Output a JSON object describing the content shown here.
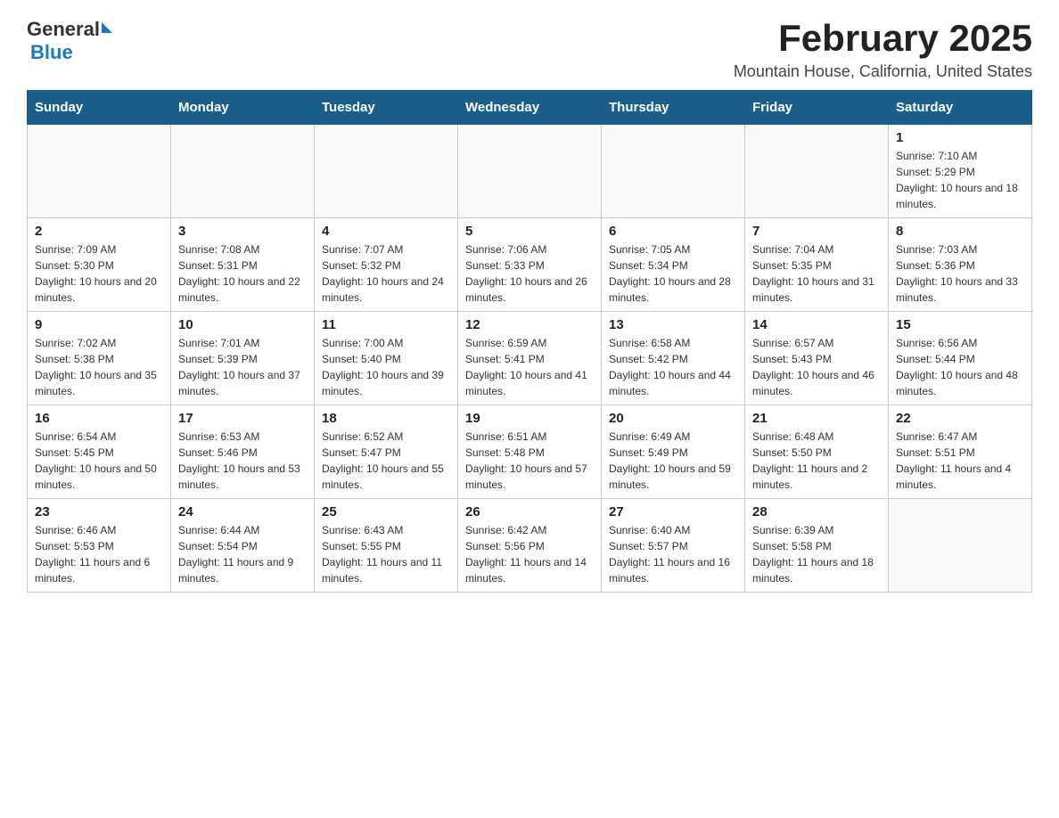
{
  "header": {
    "logo_general": "General",
    "logo_blue": "Blue",
    "title": "February 2025",
    "subtitle": "Mountain House, California, United States"
  },
  "days_of_week": [
    "Sunday",
    "Monday",
    "Tuesday",
    "Wednesday",
    "Thursday",
    "Friday",
    "Saturday"
  ],
  "weeks": [
    [
      {
        "day": "",
        "info": ""
      },
      {
        "day": "",
        "info": ""
      },
      {
        "day": "",
        "info": ""
      },
      {
        "day": "",
        "info": ""
      },
      {
        "day": "",
        "info": ""
      },
      {
        "day": "",
        "info": ""
      },
      {
        "day": "1",
        "info": "Sunrise: 7:10 AM\nSunset: 5:29 PM\nDaylight: 10 hours and 18 minutes."
      }
    ],
    [
      {
        "day": "2",
        "info": "Sunrise: 7:09 AM\nSunset: 5:30 PM\nDaylight: 10 hours and 20 minutes."
      },
      {
        "day": "3",
        "info": "Sunrise: 7:08 AM\nSunset: 5:31 PM\nDaylight: 10 hours and 22 minutes."
      },
      {
        "day": "4",
        "info": "Sunrise: 7:07 AM\nSunset: 5:32 PM\nDaylight: 10 hours and 24 minutes."
      },
      {
        "day": "5",
        "info": "Sunrise: 7:06 AM\nSunset: 5:33 PM\nDaylight: 10 hours and 26 minutes."
      },
      {
        "day": "6",
        "info": "Sunrise: 7:05 AM\nSunset: 5:34 PM\nDaylight: 10 hours and 28 minutes."
      },
      {
        "day": "7",
        "info": "Sunrise: 7:04 AM\nSunset: 5:35 PM\nDaylight: 10 hours and 31 minutes."
      },
      {
        "day": "8",
        "info": "Sunrise: 7:03 AM\nSunset: 5:36 PM\nDaylight: 10 hours and 33 minutes."
      }
    ],
    [
      {
        "day": "9",
        "info": "Sunrise: 7:02 AM\nSunset: 5:38 PM\nDaylight: 10 hours and 35 minutes."
      },
      {
        "day": "10",
        "info": "Sunrise: 7:01 AM\nSunset: 5:39 PM\nDaylight: 10 hours and 37 minutes."
      },
      {
        "day": "11",
        "info": "Sunrise: 7:00 AM\nSunset: 5:40 PM\nDaylight: 10 hours and 39 minutes."
      },
      {
        "day": "12",
        "info": "Sunrise: 6:59 AM\nSunset: 5:41 PM\nDaylight: 10 hours and 41 minutes."
      },
      {
        "day": "13",
        "info": "Sunrise: 6:58 AM\nSunset: 5:42 PM\nDaylight: 10 hours and 44 minutes."
      },
      {
        "day": "14",
        "info": "Sunrise: 6:57 AM\nSunset: 5:43 PM\nDaylight: 10 hours and 46 minutes."
      },
      {
        "day": "15",
        "info": "Sunrise: 6:56 AM\nSunset: 5:44 PM\nDaylight: 10 hours and 48 minutes."
      }
    ],
    [
      {
        "day": "16",
        "info": "Sunrise: 6:54 AM\nSunset: 5:45 PM\nDaylight: 10 hours and 50 minutes."
      },
      {
        "day": "17",
        "info": "Sunrise: 6:53 AM\nSunset: 5:46 PM\nDaylight: 10 hours and 53 minutes."
      },
      {
        "day": "18",
        "info": "Sunrise: 6:52 AM\nSunset: 5:47 PM\nDaylight: 10 hours and 55 minutes."
      },
      {
        "day": "19",
        "info": "Sunrise: 6:51 AM\nSunset: 5:48 PM\nDaylight: 10 hours and 57 minutes."
      },
      {
        "day": "20",
        "info": "Sunrise: 6:49 AM\nSunset: 5:49 PM\nDaylight: 10 hours and 59 minutes."
      },
      {
        "day": "21",
        "info": "Sunrise: 6:48 AM\nSunset: 5:50 PM\nDaylight: 11 hours and 2 minutes."
      },
      {
        "day": "22",
        "info": "Sunrise: 6:47 AM\nSunset: 5:51 PM\nDaylight: 11 hours and 4 minutes."
      }
    ],
    [
      {
        "day": "23",
        "info": "Sunrise: 6:46 AM\nSunset: 5:53 PM\nDaylight: 11 hours and 6 minutes."
      },
      {
        "day": "24",
        "info": "Sunrise: 6:44 AM\nSunset: 5:54 PM\nDaylight: 11 hours and 9 minutes."
      },
      {
        "day": "25",
        "info": "Sunrise: 6:43 AM\nSunset: 5:55 PM\nDaylight: 11 hours and 11 minutes."
      },
      {
        "day": "26",
        "info": "Sunrise: 6:42 AM\nSunset: 5:56 PM\nDaylight: 11 hours and 14 minutes."
      },
      {
        "day": "27",
        "info": "Sunrise: 6:40 AM\nSunset: 5:57 PM\nDaylight: 11 hours and 16 minutes."
      },
      {
        "day": "28",
        "info": "Sunrise: 6:39 AM\nSunset: 5:58 PM\nDaylight: 11 hours and 18 minutes."
      },
      {
        "day": "",
        "info": ""
      }
    ]
  ]
}
